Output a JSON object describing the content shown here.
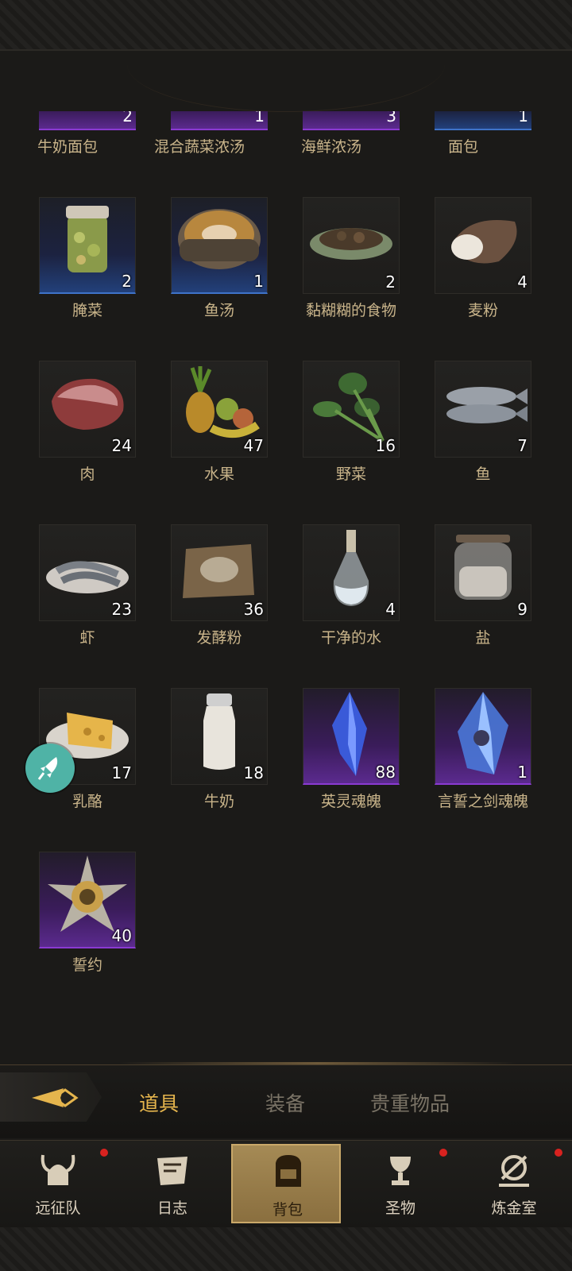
{
  "cut_row": [
    {
      "count": "2",
      "label": "牛奶面包",
      "rarity": "purple"
    },
    {
      "count": "1",
      "label": "混合蔬菜浓汤",
      "rarity": "purple"
    },
    {
      "count": "3",
      "label": "海鲜浓汤",
      "rarity": "purple"
    },
    {
      "count": "1",
      "label": "面包",
      "rarity": "blue"
    }
  ],
  "items": [
    {
      "name": "腌菜",
      "count": "2",
      "rarity": "blue",
      "icon": "pickle-jar-icon"
    },
    {
      "name": "鱼汤",
      "count": "1",
      "rarity": "blue",
      "icon": "fish-soup-icon"
    },
    {
      "name": "黏糊糊的食物",
      "count": "2",
      "rarity": "common",
      "icon": "mushy-food-icon"
    },
    {
      "name": "麦粉",
      "count": "4",
      "rarity": "common",
      "icon": "flour-sack-icon"
    },
    {
      "name": "肉",
      "count": "24",
      "rarity": "common",
      "icon": "meat-icon"
    },
    {
      "name": "水果",
      "count": "47",
      "rarity": "common",
      "icon": "fruit-icon"
    },
    {
      "name": "野菜",
      "count": "16",
      "rarity": "common",
      "icon": "wild-greens-icon"
    },
    {
      "name": "鱼",
      "count": "7",
      "rarity": "common",
      "icon": "fish-icon"
    },
    {
      "name": "虾",
      "count": "23",
      "rarity": "common",
      "icon": "shrimp-icon"
    },
    {
      "name": "发酵粉",
      "count": "36",
      "rarity": "common",
      "icon": "yeast-powder-icon"
    },
    {
      "name": "干净的水",
      "count": "4",
      "rarity": "common",
      "icon": "water-bottle-icon"
    },
    {
      "name": "盐",
      "count": "9",
      "rarity": "common",
      "icon": "salt-jar-icon"
    },
    {
      "name": "乳酪",
      "count": "17",
      "rarity": "common",
      "icon": "cheese-icon"
    },
    {
      "name": "牛奶",
      "count": "18",
      "rarity": "common",
      "icon": "milk-bottle-icon"
    },
    {
      "name": "英灵魂魄",
      "count": "88",
      "rarity": "purple",
      "icon": "blue-crystal-icon"
    },
    {
      "name": "言誓之剑魂魄",
      "count": "1",
      "rarity": "purple",
      "icon": "sword-soul-crystal-icon"
    },
    {
      "name": "誓约",
      "count": "40",
      "rarity": "purple",
      "icon": "oath-medal-icon"
    }
  ],
  "tabs": [
    {
      "label": "道具",
      "active": true
    },
    {
      "label": "装备",
      "active": false
    },
    {
      "label": "贵重物品",
      "active": false
    }
  ],
  "nav": [
    {
      "label": "远征队",
      "icon": "viking-helmet-icon",
      "badge": true,
      "active": false
    },
    {
      "label": "日志",
      "icon": "scroll-icon",
      "badge": false,
      "active": false
    },
    {
      "label": "背包",
      "icon": "backpack-icon",
      "badge": false,
      "active": true
    },
    {
      "label": "圣物",
      "icon": "chalice-icon",
      "badge": true,
      "active": false
    },
    {
      "label": "炼金室",
      "icon": "alchemy-icon",
      "badge": true,
      "active": false
    }
  ],
  "colors": {
    "accent": "#e5b54d",
    "blue_rarity": "#3f73c9",
    "purple_rarity": "#8a3ad1",
    "badge": "#d8221f"
  }
}
